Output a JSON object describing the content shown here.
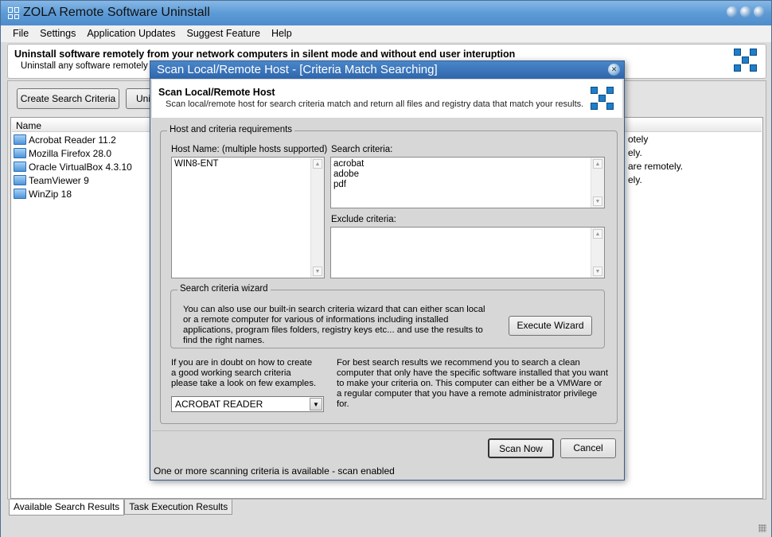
{
  "app": {
    "title": "ZOLA Remote Software Uninstall"
  },
  "menu": [
    "File",
    "Settings",
    "Application Updates",
    "Suggest Feature",
    "Help"
  ],
  "header": {
    "title": "Uninstall software remotely from your network computers in silent mode and without end user interuption",
    "subtitle": "Uninstall any software remotely bas"
  },
  "toolbar": {
    "create_label": "Create Search Criteria",
    "uninstall_label": "Uni"
  },
  "list": {
    "column": "Name",
    "items": [
      {
        "name": "Acrobat Reader 11.2",
        "desc": "otely"
      },
      {
        "name": "Mozilla Firefox 28.0",
        "desc": "ely."
      },
      {
        "name": "Oracle VirtualBox 4.3.10",
        "desc": "are remotely."
      },
      {
        "name": "TeamViewer 9",
        "desc": "ely."
      },
      {
        "name": "WinZip 18",
        "desc": ""
      }
    ]
  },
  "tabs": [
    "Available Search Results",
    "Task Execution Results"
  ],
  "dialog": {
    "title": "Scan Local/Remote Host - [Criteria Match Searching]",
    "heading": "Scan Local/Remote Host",
    "subheading": "Scan local/remote host for search criteria match and return all files and registry data that match your results.",
    "group_label": "Host and criteria requirements",
    "host_label": "Host Name: (multiple hosts supported)",
    "host_value": "WIN8-ENT",
    "criteria_label": "Search criteria:",
    "criteria_lines": [
      "acrobat",
      "adobe",
      "pdf"
    ],
    "exclude_label": "Exclude criteria:",
    "wizard_group": "Search criteria wizard",
    "wizard_text": "You can also use our built-in search criteria wizard that can either scan local or a remote computer for various of informations including installed applications, program files folders, registry keys etc... and use the results to find the right names.",
    "wizard_button": "Execute Wizard",
    "examples_text": "If you are in doubt on how to create a good working search criteria please take a look on few examples.",
    "examples_selected": "ACROBAT READER",
    "tip_text": "For best search results we recommend you to search a clean computer that only have the specific software installed that you want to make your criteria on. This computer can either be a VMWare or a regular computer that you have a remote administrator privilege for.",
    "scan_button": "Scan Now",
    "cancel_button": "Cancel",
    "status": "One or more scanning criteria is available - scan enabled"
  }
}
